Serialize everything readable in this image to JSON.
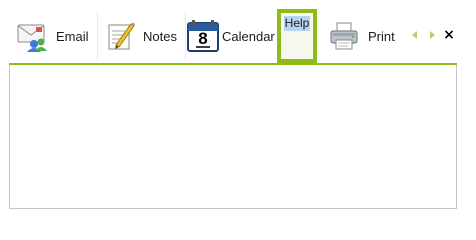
{
  "tabs": [
    {
      "label": "Email",
      "icon": "email-icon"
    },
    {
      "label": "Notes",
      "icon": "notes-icon"
    },
    {
      "label": "Calendar",
      "icon": "calendar-icon",
      "icon_text": "8"
    },
    {
      "label": "Help",
      "icon": null,
      "selected": true
    },
    {
      "label": "Print",
      "icon": "printer-icon"
    }
  ],
  "controls": {
    "scroll_left_icon": "scroll-left-icon",
    "scroll_right_icon": "scroll-right-icon",
    "close_glyph": "×"
  },
  "colors": {
    "accent": "#8dbb1a",
    "selection_highlight": "#b9d3f0"
  }
}
